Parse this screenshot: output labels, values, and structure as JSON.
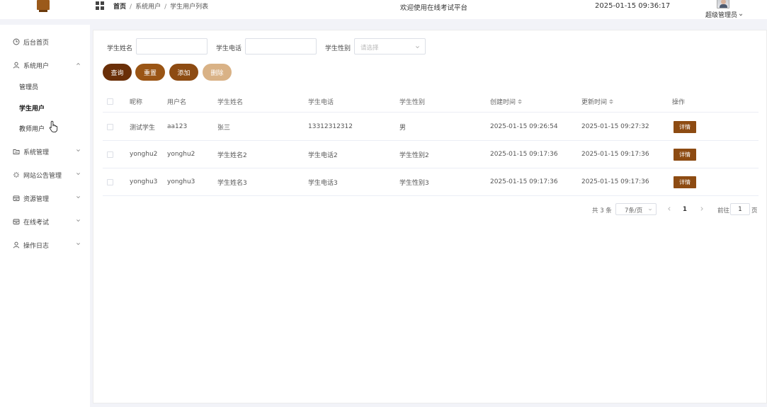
{
  "header": {
    "breadcrumb": [
      "首页",
      "系统用户",
      "学生用户列表"
    ],
    "welcome": "欢迎使用在线考试平台",
    "datetime": "2025-01-15 09:36:17",
    "user": "超级管理员"
  },
  "sidebar": {
    "items": [
      {
        "label": "后台首页",
        "icon": "clock-icon"
      },
      {
        "label": "系统用户",
        "icon": "user-icon",
        "expanded": true,
        "children": [
          {
            "label": "管理员"
          },
          {
            "label": "学生用户",
            "active": true
          },
          {
            "label": "教师用户"
          }
        ]
      },
      {
        "label": "系统管理",
        "icon": "folder-icon"
      },
      {
        "label": "网站公告管理",
        "icon": "sparkle-icon"
      },
      {
        "label": "资源管理",
        "icon": "box-icon"
      },
      {
        "label": "在线考试",
        "icon": "box-icon"
      },
      {
        "label": "操作日志",
        "icon": "user-icon"
      }
    ]
  },
  "search": {
    "name_label": "学生姓名",
    "phone_label": "学生电话",
    "gender_label": "学生性别",
    "gender_placeholder": "请选择"
  },
  "buttons": {
    "query": "查询",
    "reset": "重置",
    "add": "添加",
    "delete": "删除"
  },
  "table": {
    "headers": [
      "昵称",
      "用户名",
      "学生姓名",
      "学生电话",
      "学生性别",
      "创建时间",
      "更新时间",
      "操作"
    ],
    "rows": [
      {
        "nickname": "测试学生",
        "username": "aa123",
        "name": "张三",
        "phone": "13312312312",
        "gender": "男",
        "created": "2025-01-15 09:26:54",
        "updated": "2025-01-15 09:27:32",
        "action": "详情"
      },
      {
        "nickname": "yonghu2",
        "username": "yonghu2",
        "name": "学生姓名2",
        "phone": "学生电话2",
        "gender": "学生性别2",
        "created": "2025-01-15 09:17:36",
        "updated": "2025-01-15 09:17:36",
        "action": "详情"
      },
      {
        "nickname": "yonghu3",
        "username": "yonghu3",
        "name": "学生姓名3",
        "phone": "学生电话3",
        "gender": "学生性别3",
        "created": "2025-01-15 09:17:36",
        "updated": "2025-01-15 09:17:36",
        "action": "详情"
      }
    ]
  },
  "pagination": {
    "total": "共 3 条",
    "page_size": "7条/页",
    "current_page": "1",
    "goto_label": "前往",
    "goto_value": "1",
    "page_unit": "页"
  },
  "colors": {
    "accent_dark": "#6a2f08",
    "accent": "#8d4b12",
    "accent_light": "#d9b286"
  }
}
